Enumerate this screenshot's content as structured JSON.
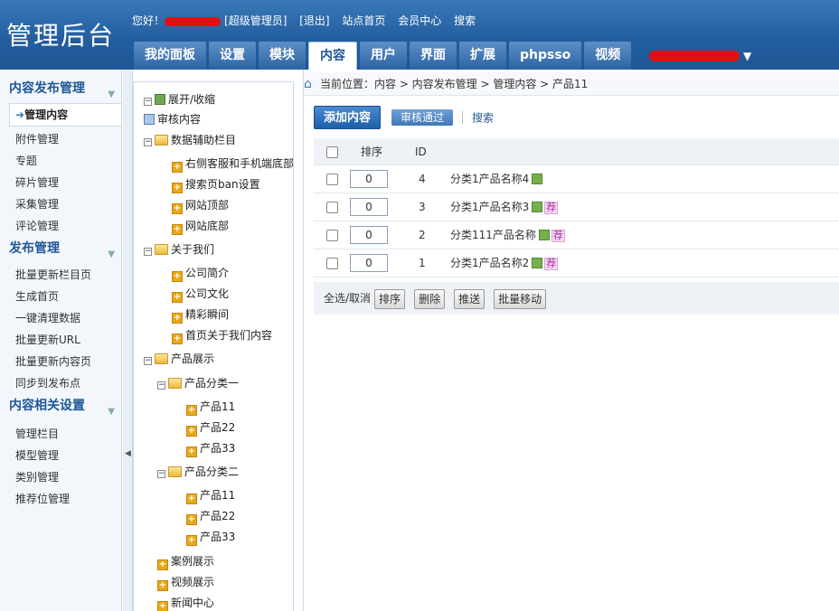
{
  "header": {
    "logo": "管理后台",
    "greeting": "您好！",
    "role": "[超级管理员]",
    "logout": "[退出]",
    "site_home": "站点首页",
    "member_center": "会员中心",
    "search": "搜索"
  },
  "tabs": [
    "我的面板",
    "设置",
    "模块",
    "内容",
    "用户",
    "界面",
    "扩展",
    "phpsso",
    "视频"
  ],
  "active_tab": "内容",
  "sidebar": {
    "sections": [
      {
        "title": "内容发布管理",
        "items": [
          "管理内容",
          "附件管理",
          "专题",
          "碎片管理",
          "采集管理",
          "评论管理"
        ]
      },
      {
        "title": "发布管理",
        "items": [
          "批量更新栏目页",
          "生成首页",
          "一键清理数据",
          "批量更新URL",
          "批量更新内容页",
          "同步到发布点"
        ]
      },
      {
        "title": "内容相关设置",
        "items": [
          "管理栏目",
          "模型管理",
          "类别管理",
          "推荐位管理"
        ]
      }
    ]
  },
  "tree": {
    "toggle": "展开/收缩",
    "review": "审核内容",
    "nodes": {
      "data_aux": "数据辅助栏目",
      "kefu": "右侧客服和手机端底部",
      "search_ban": "搜索页ban设置",
      "site_top": "网站顶部",
      "site_bottom": "网站底部",
      "about": "关于我们",
      "company": "公司简介",
      "culture": "公司文化",
      "moments": "精彩瞬间",
      "home_about": "首页关于我们内容",
      "products": "产品展示",
      "cat1": "产品分类一",
      "cat1_p11": "产品11",
      "cat1_p22": "产品22",
      "cat1_p33": "产品33",
      "cat2": "产品分类二",
      "cat2_p11": "产品11",
      "cat2_p22": "产品22",
      "cat2_p33": "产品33",
      "cases": "案例展示",
      "video": "视频展示",
      "news": "新闻中心"
    }
  },
  "breadcrumb": "当前位置：内容 > 内容发布管理 > 管理内容 > 产品11",
  "actions": {
    "add": "添加内容",
    "approved": "审核通过",
    "search": "搜索"
  },
  "table": {
    "headers": {
      "order": "排序",
      "id": "ID"
    },
    "rows": [
      {
        "order": "0",
        "id": "4",
        "title": "分类1产品名称4",
        "tj": ""
      },
      {
        "order": "0",
        "id": "3",
        "title": "分类1产品名称3",
        "tj": "荐"
      },
      {
        "order": "0",
        "id": "2",
        "title": "分类111产品名称",
        "tj": "荐"
      },
      {
        "order": "0",
        "id": "1",
        "title": "分类1产品名称2",
        "tj": "荐"
      }
    ]
  },
  "footer": {
    "select_all": "全选/取消",
    "sort": "排序",
    "delete": "删除",
    "push": "推送",
    "move": "批量移动"
  }
}
